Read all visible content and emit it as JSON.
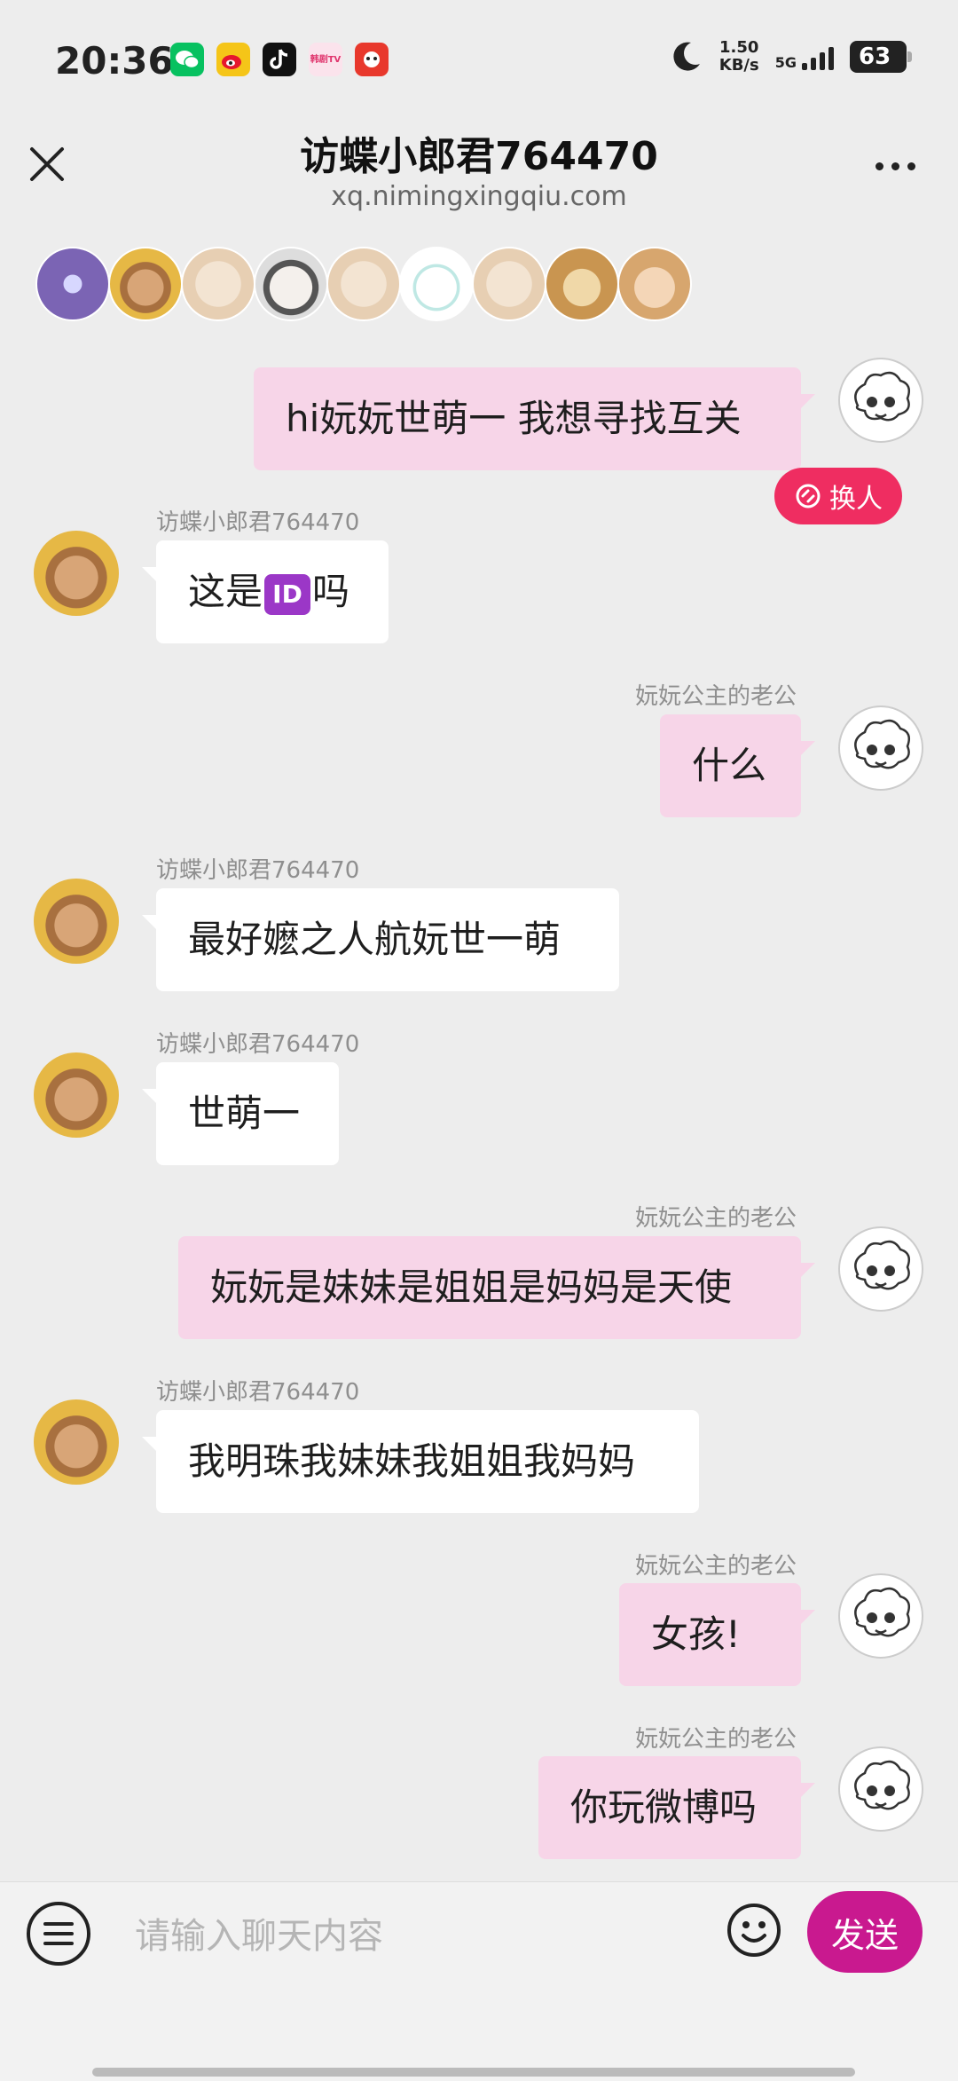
{
  "status_bar": {
    "time": "20:36",
    "net_speed_value": "1.50",
    "net_speed_unit": "KB/s",
    "network": "5G",
    "battery": "63",
    "app_icons": [
      "wechat-icon",
      "weibo-icon",
      "tiktok-icon",
      "tv-app-icon",
      "red-app-icon"
    ],
    "tv_app_label": "韩剧TV"
  },
  "header": {
    "title": "访蝶小郎君764470",
    "subtitle": "xq.nimingxingqiu.com"
  },
  "swap_button": {
    "label": "换人"
  },
  "messages": [
    {
      "side": "out",
      "sender": "",
      "text": "hi妧妧世萌一 我想寻找互关"
    },
    {
      "side": "in",
      "sender": "访蝶小郎君764470",
      "text_before": "这是",
      "emoji": "ID",
      "text_after": "吗"
    },
    {
      "side": "out",
      "sender": "妧妧公主的老公",
      "text": "什么"
    },
    {
      "side": "in",
      "sender": "访蝶小郎君764470",
      "text": "最好嬷之人航妧世一萌"
    },
    {
      "side": "in",
      "sender": "访蝶小郎君764470",
      "text": "世萌一"
    },
    {
      "side": "out",
      "sender": "妧妧公主的老公",
      "text": "妧妧是妹妹是姐姐是妈妈是天使"
    },
    {
      "side": "in",
      "sender": "访蝶小郎君764470",
      "text": "我明珠我妹妹我姐姐我妈妈"
    },
    {
      "side": "out",
      "sender": "妧妧公主的老公",
      "text": "女孩!"
    },
    {
      "side": "out",
      "sender": "妧妧公主的老公",
      "text": "你玩微博吗"
    }
  ],
  "composer": {
    "placeholder": "请输入聊天内容",
    "send_label": "发送"
  },
  "colors": {
    "outgoing_bubble": "#f7d5e8",
    "incoming_bubble": "#ffffff",
    "send_button": "#c9198f",
    "swap_button": "#ef2d61"
  }
}
